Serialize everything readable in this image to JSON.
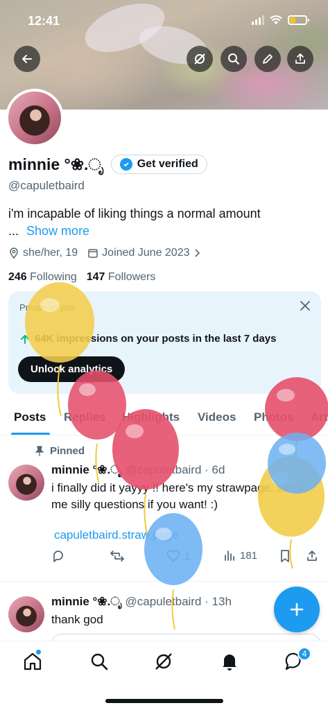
{
  "status_bar": {
    "time": "12:41"
  },
  "header": {
    "back": "back",
    "icons": [
      "grok-icon",
      "search-icon",
      "edit-icon",
      "share-icon"
    ]
  },
  "profile": {
    "name": "minnie °❀.ೃ",
    "verify_label": "Get verified",
    "handle": "@capuletbaird",
    "bio": "i'm incapable of liking things a normal amount",
    "bio_ellipsis": "...",
    "show_more": "Show more",
    "pronouns": "she/her, 19",
    "joined": "Joined June 2023",
    "following_count": "246",
    "following_label": "Following",
    "followers_count": "147",
    "followers_label": "Followers"
  },
  "analytics_card": {
    "title": "Private to you",
    "text": "64K impressions on your posts in the last 7 days",
    "button": "Unlock analytics"
  },
  "tabs": [
    {
      "label": "Posts",
      "active": true
    },
    {
      "label": "Replies"
    },
    {
      "label": "Highlights"
    },
    {
      "label": "Videos"
    },
    {
      "label": "Photos"
    },
    {
      "label": "Articles"
    }
  ],
  "posts": [
    {
      "pinned_label": "Pinned",
      "name": "minnie °❀.ೃ",
      "meta": "@capuletbaird · 6d",
      "text": "i finally did it yayyy !! here's my strawpage, send me silly questions if you want! :)",
      "link": "capuletbaird.straw.page",
      "likes": "1",
      "views": "181"
    },
    {
      "name": "minnie °❀.ೃ",
      "meta": "@capuletbaird · 13h",
      "text": "thank god"
    }
  ],
  "bottom_nav": {
    "messages_badge": "4"
  },
  "colors": {
    "accent": "#1d9bf0",
    "text": "#0f1419",
    "muted": "#536471"
  }
}
